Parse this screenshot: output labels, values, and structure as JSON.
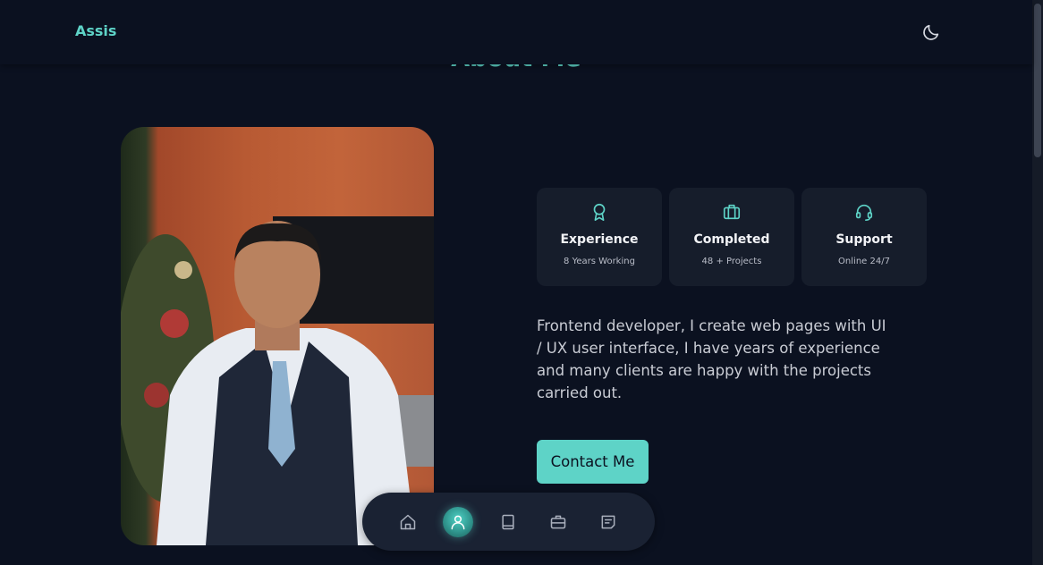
{
  "header": {
    "logo": "Assis"
  },
  "section": {
    "title": "About Me"
  },
  "stats": [
    {
      "icon": "award-icon",
      "title": "Experience",
      "subtitle": "8 Years Working"
    },
    {
      "icon": "briefcase-icon",
      "title": "Completed",
      "subtitle": "48 + Projects"
    },
    {
      "icon": "headset-icon",
      "title": "Support",
      "subtitle": "Online 24/7"
    }
  ],
  "about": {
    "description": "Frontend developer, I create web pages with UI / UX user interface, I have years of experience and many clients are happy with the projects carried out.",
    "contact_label": "Contact Me"
  },
  "nav": {
    "items": [
      "home-icon",
      "user-icon",
      "book-icon",
      "briefcase-icon",
      "message-icon"
    ],
    "active": "user-icon"
  },
  "colors": {
    "accent": "#5ed3c7",
    "background": "#0b1120",
    "card": "#161d2b"
  }
}
